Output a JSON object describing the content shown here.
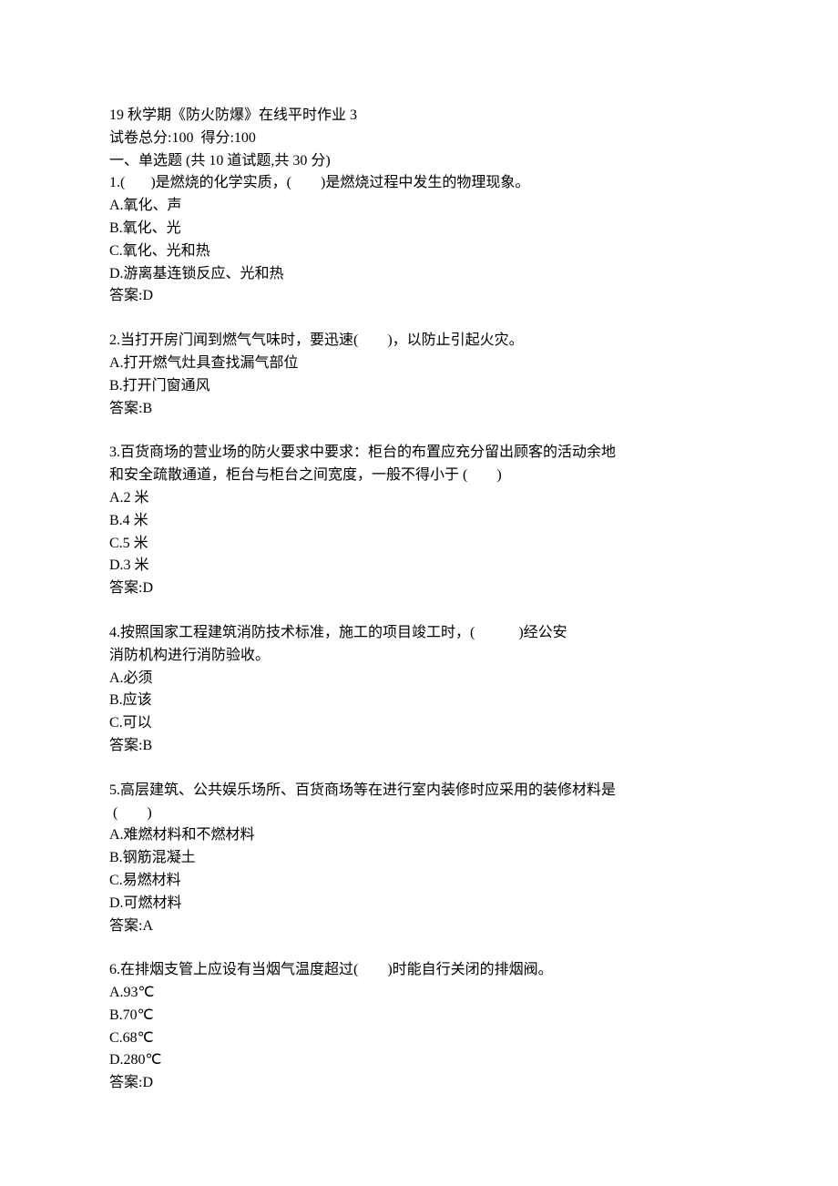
{
  "header": {
    "title": "19 秋学期《防火防爆》在线平时作业 3",
    "score_line": "试卷总分:100  得分:100",
    "section_title": "一、单选题 (共 10 道试题,共 30 分)"
  },
  "answer_label_prefix": "答案:",
  "questions": [
    {
      "number": "1",
      "stem": "1.(       )是燃烧的化学实质，(        )是燃烧过程中发生的物理现象。",
      "options": [
        "A.氧化、声",
        "B.氧化、光",
        "C.氧化、光和热",
        "D.游离基连锁反应、光和热"
      ],
      "answer": "D"
    },
    {
      "number": "2",
      "stem": "2.当打开房门闻到燃气气味时，要迅速(        )，以防止引起火灾。",
      "options": [
        "A.打开燃气灶具查找漏气部位",
        "B.打开门窗通风"
      ],
      "answer": "B"
    },
    {
      "number": "3",
      "stem": "3.百货商场的营业场的防火要求中要求：柜台的布置应充分留出顾客的活动余地\n和安全疏散通道，柜台与柜台之间宽度，一般不得小于 (        )",
      "options": [
        "A.2 米",
        "B.4 米",
        "C.5 米",
        "D.3 米"
      ],
      "answer": "D"
    },
    {
      "number": "4",
      "stem": "4.按照国家工程建筑消防技术标准，施工的项目竣工时，(            )经公安\n消防机构进行消防验收。",
      "options": [
        "A.必须",
        "B.应该",
        "C.可以"
      ],
      "answer": "B"
    },
    {
      "number": "5",
      "stem": "5.高层建筑、公共娱乐场所、百货商场等在进行室内装修时应采用的装修材料是\n (        )",
      "options": [
        "A.难燃材料和不燃材料",
        "B.钢筋混凝土",
        "C.易燃材料",
        "D.可燃材料"
      ],
      "answer": "A"
    },
    {
      "number": "6",
      "stem": "6.在排烟支管上应设有当烟气温度超过(        )时能自行关闭的排烟阀。",
      "options": [
        "A.93℃",
        "B.70℃",
        "C.68℃",
        "D.280℃"
      ],
      "answer": "D"
    }
  ]
}
